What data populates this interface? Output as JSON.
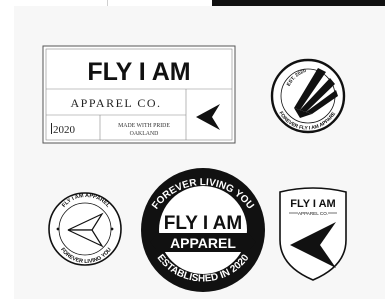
{
  "brand": {
    "name": "FLY I AM",
    "line1": "FLY I AM",
    "apparel": "APPAREL",
    "apparel_co": "APPAREL CO.",
    "year": "2020",
    "tagline1": "MADE WITH PRIDE",
    "tagline2": "OAKLAND",
    "est": "EST. 2020",
    "forever": "FOREVER LIVING YOU",
    "forever_co": "FOREVER FLY I AM APPAREL CO.",
    "established": "ESTABLISHED IN 2020",
    "round_top": "FLY I AM APPAREL",
    "round_bottom": "FOREVER LIVING YOU"
  },
  "colors": {
    "ink": "#111111",
    "paper": "#ffffff",
    "canvas": "#f7f7f7",
    "rule": "#555555"
  }
}
